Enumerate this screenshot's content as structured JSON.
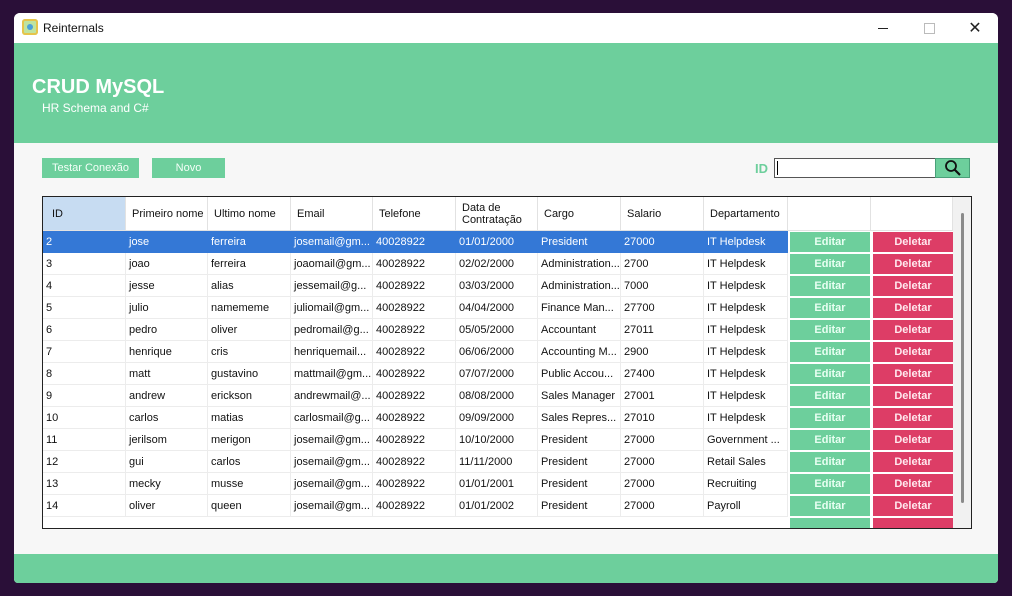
{
  "window": {
    "title": "Reinternals"
  },
  "header": {
    "title": "CRUD MySQL",
    "subtitle": "HR Schema and C#"
  },
  "toolbar": {
    "test_connection_label": "Testar Conexão",
    "new_label": "Novo",
    "id_label": "ID",
    "search_value": ""
  },
  "colors": {
    "accent": "#6dcf9c",
    "delete": "#dd3d66",
    "selected": "#3478d6",
    "header_selected": "#c7dcf2"
  },
  "table": {
    "columns": [
      "ID",
      "Primeiro nome",
      "Ultimo nome",
      "Email",
      "Telefone",
      "Data de Contratação",
      "Cargo",
      "Salario",
      "Departamento"
    ],
    "edit_label": "Editar",
    "delete_label": "Deletar",
    "rows": [
      [
        "2",
        "jose",
        "ferreira",
        "josemail@gm...",
        "40028922",
        "01/01/2000",
        "President",
        "27000",
        "IT Helpdesk"
      ],
      [
        "3",
        "joao",
        "ferreira",
        "joaomail@gm...",
        "40028922",
        "02/02/2000",
        "Administration...",
        "2700",
        "IT Helpdesk"
      ],
      [
        "4",
        "jesse",
        "alias",
        "jessemail@g...",
        "40028922",
        "03/03/2000",
        "Administration...",
        "7000",
        "IT Helpdesk"
      ],
      [
        "5",
        "julio",
        "namememe",
        "juliomail@gm...",
        "40028922",
        "04/04/2000",
        "Finance Man...",
        "27700",
        "IT Helpdesk"
      ],
      [
        "6",
        "pedro",
        "oliver",
        "pedromail@g...",
        "40028922",
        "05/05/2000",
        "Accountant",
        "27011",
        "IT Helpdesk"
      ],
      [
        "7",
        "henrique",
        "cris",
        "henriquemail...",
        "40028922",
        "06/06/2000",
        "Accounting M...",
        "2900",
        "IT Helpdesk"
      ],
      [
        "8",
        "matt",
        "gustavino",
        "mattmail@gm...",
        "40028922",
        "07/07/2000",
        "Public Accou...",
        "27400",
        "IT Helpdesk"
      ],
      [
        "9",
        "andrew",
        "erickson",
        "andrewmail@...",
        "40028922",
        "08/08/2000",
        "Sales Manager",
        "27001",
        "IT Helpdesk"
      ],
      [
        "10",
        "carlos",
        "matias",
        "carlosmail@g...",
        "40028922",
        "09/09/2000",
        "Sales Repres...",
        "27010",
        "IT Helpdesk"
      ],
      [
        "11",
        "jerilsom",
        "merigon",
        "josemail@gm...",
        "40028922",
        "10/10/2000",
        "President",
        "27000",
        "Government ..."
      ],
      [
        "12",
        "gui",
        "carlos",
        "josemail@gm...",
        "40028922",
        "11/11/2000",
        "President",
        "27000",
        "Retail Sales"
      ],
      [
        "13",
        "mecky",
        "musse",
        "josemail@gm...",
        "40028922",
        "01/01/2001",
        "President",
        "27000",
        "Recruiting"
      ],
      [
        "14",
        "oliver",
        "queen",
        "josemail@gm...",
        "40028922",
        "01/01/2002",
        "President",
        "27000",
        "Payroll"
      ]
    ],
    "selected_row": 0
  },
  "icons": {
    "app": "app-icon",
    "search": "search-icon",
    "minimize": "minimize-icon",
    "maximize": "maximize-icon",
    "close": "close-icon"
  }
}
